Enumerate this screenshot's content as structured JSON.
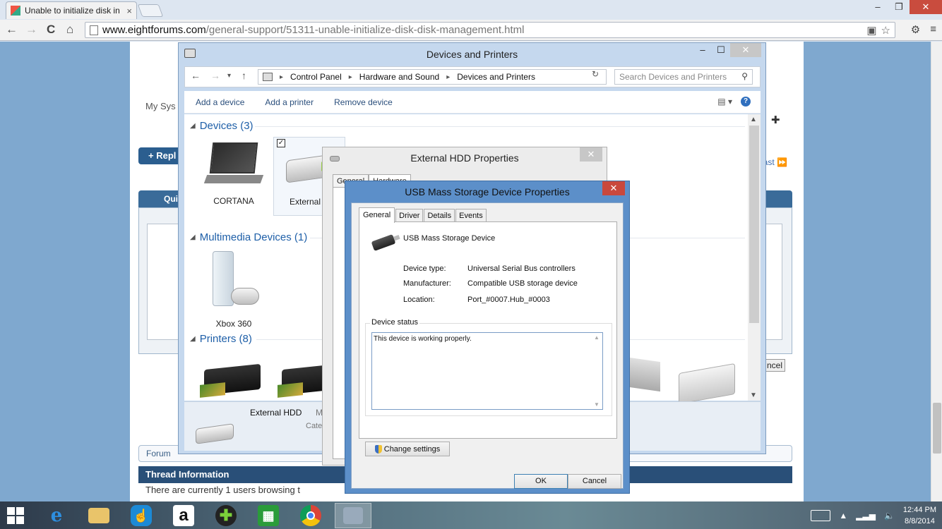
{
  "browser": {
    "tab_title": "Unable to initialize disk in",
    "tab_close": "×",
    "url_domain": "www.eightforums.com",
    "url_path": "/general-support/51311-unable-initialize-disk-disk-management.html",
    "minimize": "–",
    "restore": "❐",
    "close": "✕",
    "back": "←",
    "forward": "→",
    "reload": "C",
    "home": "⌂",
    "star": "☆"
  },
  "forum": {
    "my_system": "My Sys",
    "reply_label": "+ Repl",
    "quick_reply": "Qui",
    "last_link": "Last ⏩",
    "cancel_fragment": "ncel",
    "breadcrumb_first": "Forum",
    "thread_info_title": "Thread Information",
    "thread_info_text": "There are currently 1 users browsing t"
  },
  "devices_window": {
    "title": "Devices and Printers",
    "minimize": "–",
    "maximize": "☐",
    "close": "✕",
    "nav_back": "←",
    "nav_forward": "→",
    "nav_recent": "▾",
    "nav_up": "↑",
    "breadcrumb": [
      "Control Panel",
      "Hardware and Sound",
      "Devices and Printers"
    ],
    "breadcrumb_sep": "▸",
    "refresh": "↻",
    "search_placeholder": "Search Devices and Printers",
    "commands": [
      "Add a device",
      "Add a printer",
      "Remove device"
    ],
    "groups": {
      "devices": "Devices (3)",
      "multimedia": "Multimedia Devices (1)",
      "printers": "Printers (8)"
    },
    "device_items": [
      "CORTANA",
      "External H"
    ],
    "multimedia_items": [
      "Xbox 360"
    ],
    "details": {
      "name": "External HDD",
      "sub": "M",
      "sub2": "Cate"
    }
  },
  "external_hdd_dialog": {
    "title": "External HDD Properties",
    "close": "✕",
    "tabs": [
      "General",
      "Hardware"
    ]
  },
  "usb_dialog": {
    "title": "USB Mass Storage Device Properties",
    "close": "✕",
    "tabs": [
      "General",
      "Driver",
      "Details",
      "Events"
    ],
    "device_name": "USB Mass Storage Device",
    "device_type_label": "Device type:",
    "device_type": "Universal Serial Bus controllers",
    "manufacturer_label": "Manufacturer:",
    "manufacturer": "Compatible USB storage device",
    "location_label": "Location:",
    "location": "Port_#0007.Hub_#0003",
    "status_legend": "Device status",
    "status_text": "This device is working properly.",
    "change_settings": "Change settings",
    "ok": "OK",
    "cancel": "Cancel"
  },
  "taskbar": {
    "clock_time": "12:44 PM",
    "clock_date": "8/8/2014",
    "tray_chevron": "▲",
    "amazon_glyph": "a"
  },
  "colors": {
    "accent_blue": "#1e5fa8",
    "dialog_frame": "#5c8fc9",
    "close_red": "#c9483c",
    "forum_header": "#294f78"
  }
}
